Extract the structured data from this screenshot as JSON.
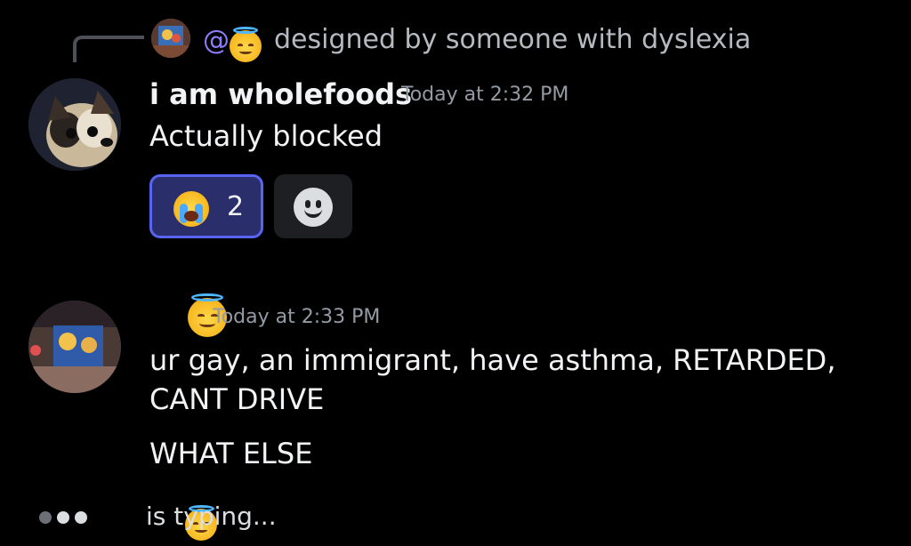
{
  "reply": {
    "mention": "@",
    "text": "designed by someone with dyslexia"
  },
  "message1": {
    "username": "i am wholefoods",
    "timestamp": "Today at 2:32 PM",
    "content": "Actually blocked",
    "reactions": [
      {
        "emoji": "loudly-crying-face",
        "count": "2",
        "active": true
      }
    ]
  },
  "message2": {
    "username_emoji": "smiling-face-with-halo",
    "timestamp": "Today at 2:33 PM",
    "lines": [
      "ur gay, an immigrant, have asthma, RETARDED,",
      "CANT DRIVE"
    ],
    "followup": "WHAT ELSE"
  },
  "typing": {
    "text": "is typing..."
  },
  "colors": {
    "background": "#000000",
    "mention": "#8e7cf7",
    "reaction_border": "#5865f2",
    "reaction_bg": "#2a2e6b",
    "timestamp": "#949ba4"
  }
}
